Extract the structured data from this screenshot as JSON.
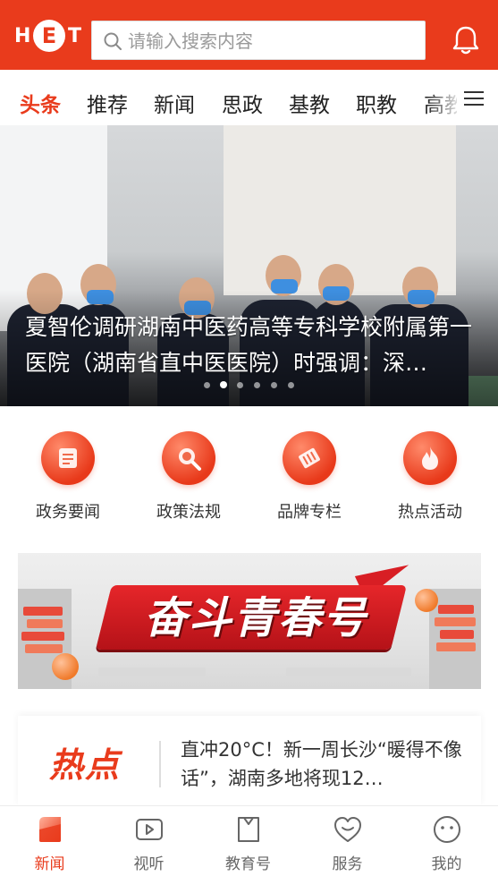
{
  "header": {
    "logo": {
      "h": "H",
      "e": "E",
      "t": "T"
    },
    "search_placeholder": "请输入搜索内容",
    "brand_color": "#e93b1c",
    "icons": {
      "search": "search-icon",
      "notification": "bell-icon"
    }
  },
  "tabs": {
    "items": [
      {
        "label": "头条",
        "active": true
      },
      {
        "label": "推荐",
        "active": false
      },
      {
        "label": "新闻",
        "active": false
      },
      {
        "label": "思政",
        "active": false
      },
      {
        "label": "基教",
        "active": false
      },
      {
        "label": "职教",
        "active": false
      },
      {
        "label": "高教",
        "active": false
      }
    ],
    "menu_icon": "menu-icon"
  },
  "banner": {
    "caption": "夏智伦调研湖南中医药高等专科学校附属第一医院（湖南省直中医医院）时强调：深…",
    "slide_count": 6,
    "active_slide": 2
  },
  "quick_links": [
    {
      "label": "政务要闻",
      "icon": "document-icon"
    },
    {
      "label": "政策法规",
      "icon": "magnifier-icon"
    },
    {
      "label": "品牌专栏",
      "icon": "ticket-icon"
    },
    {
      "label": "热点活动",
      "icon": "flame-icon"
    }
  ],
  "promo": {
    "title": "奋斗青春号"
  },
  "hot": {
    "tag": "热点",
    "text": "直冲20°C！新一周长沙“暖得不像话”，湖南多地将现12…"
  },
  "bottom_nav": [
    {
      "label": "新闻",
      "icon": "news-icon",
      "active": true
    },
    {
      "label": "视听",
      "icon": "video-icon",
      "active": false
    },
    {
      "label": "教育号",
      "icon": "book-icon",
      "active": false
    },
    {
      "label": "服务",
      "icon": "heart-icon",
      "active": false
    },
    {
      "label": "我的",
      "icon": "profile-icon",
      "active": false
    }
  ]
}
